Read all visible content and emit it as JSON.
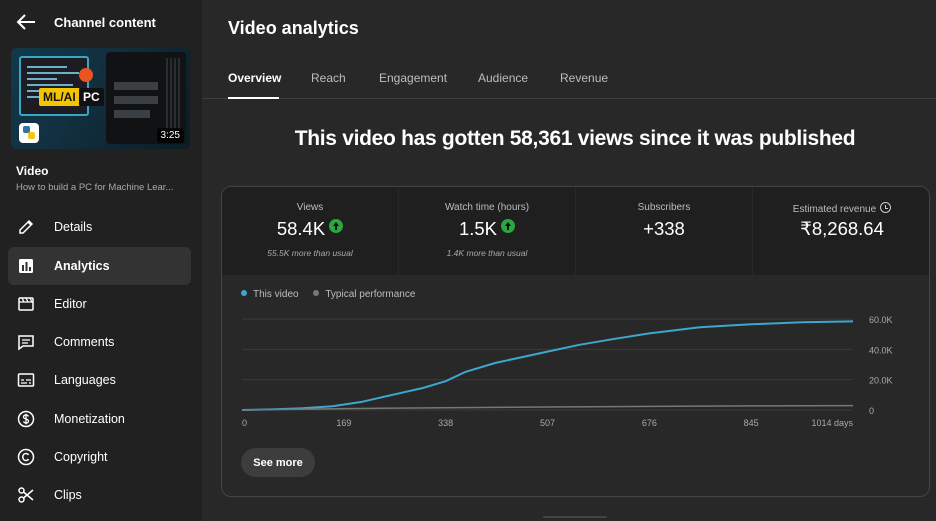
{
  "sidebar": {
    "title": "Channel content",
    "thumbnail": {
      "duration": "3:25",
      "badge_a": "ML/AI",
      "badge_b": "PC"
    },
    "video_label": "Video",
    "video_title": "How to build a PC for Machine Lear...",
    "items": [
      {
        "label": "Details",
        "icon": "pencil-icon"
      },
      {
        "label": "Analytics",
        "icon": "bar-chart-icon",
        "active": true
      },
      {
        "label": "Editor",
        "icon": "film-icon"
      },
      {
        "label": "Comments",
        "icon": "comment-icon"
      },
      {
        "label": "Languages",
        "icon": "subtitles-icon"
      },
      {
        "label": "Monetization",
        "icon": "dollar-icon"
      },
      {
        "label": "Copyright",
        "icon": "copyright-icon"
      },
      {
        "label": "Clips",
        "icon": "scissors-icon"
      }
    ]
  },
  "header": {
    "title": "Video analytics",
    "tabs": [
      "Overview",
      "Reach",
      "Engagement",
      "Audience",
      "Revenue"
    ],
    "active_tab": "Overview"
  },
  "headline": "This video has gotten 58,361 views since it was published",
  "metrics": [
    {
      "label": "Views",
      "value": "58.4K",
      "sub": "55.5K more than usual",
      "trend": "up"
    },
    {
      "label": "Watch time (hours)",
      "value": "1.5K",
      "sub": "1.4K more than usual",
      "trend": "up"
    },
    {
      "label": "Subscribers",
      "value": "+338",
      "sub": ""
    },
    {
      "label": "Estimated revenue",
      "value": "₹8,268.64",
      "sub": ""
    }
  ],
  "see_more_label": "See more",
  "colors": {
    "this_video": "#3ea6d0",
    "typical": "#777777",
    "trend_up": "#2ba640"
  },
  "chart_data": {
    "type": "line",
    "legend": [
      "This video",
      "Typical performance"
    ],
    "x_ticks": [
      "0",
      "169",
      "338",
      "507",
      "676",
      "845",
      "1014 days"
    ],
    "y_ticks": [
      "0",
      "20.0K",
      "40.0K",
      "60.0K"
    ],
    "xlim": [
      0,
      1014
    ],
    "ylim": [
      0,
      60000
    ],
    "grid": true,
    "series": [
      {
        "name": "This video",
        "x": [
          0,
          50,
          100,
          150,
          200,
          250,
          300,
          338,
          370,
          420,
          507,
          560,
          620,
          676,
          760,
          845,
          930,
          1014
        ],
        "y": [
          0,
          400,
          1200,
          2500,
          5500,
          10000,
          14500,
          19000,
          25000,
          31000,
          38500,
          43000,
          47000,
          50500,
          54500,
          56500,
          57800,
          58400
        ]
      },
      {
        "name": "Typical performance",
        "x": [
          0,
          169,
          338,
          507,
          676,
          845,
          1014
        ],
        "y": [
          0,
          900,
          1500,
          2000,
          2400,
          2700,
          2900
        ]
      }
    ]
  }
}
